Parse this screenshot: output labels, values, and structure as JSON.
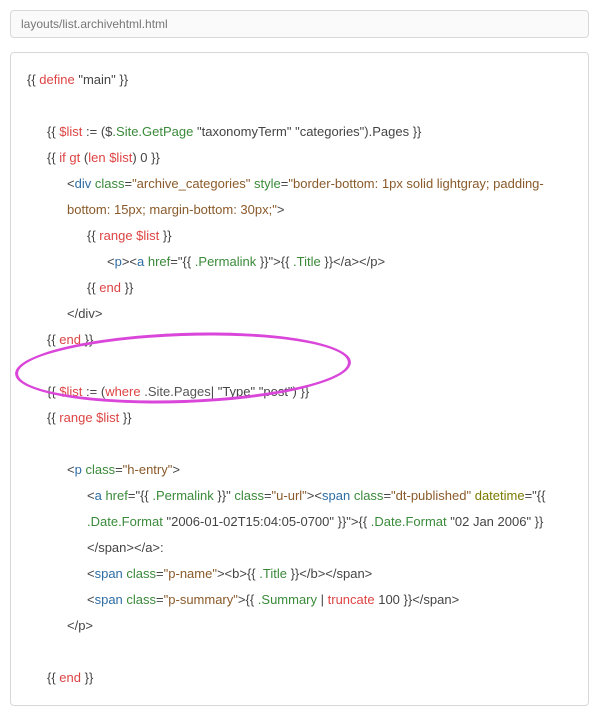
{
  "filename": "layouts/list.archivehtml.html",
  "code": {
    "l1_open": "{{ ",
    "l1_define": "define",
    "l1_rest": " \"main\" }}",
    "l3_open": "{{ ",
    "l3_var": "$list",
    "l3_mid": " := ($",
    "l3_site": ".Site.GetPage",
    "l3_rest": " \"taxonomyTerm\" \"categories\").Pages }}",
    "l4_open": "{{ ",
    "l4_if": "if gt ",
    "l4_paren": "(",
    "l4_len": "len",
    "l4_sp": " ",
    "l4_var": "$list",
    "l4_close": ") 0 }}",
    "l5_open": "<",
    "l5_div": "div",
    "l5_sp": " ",
    "l5_class": "class",
    "l5_eq": "=",
    "l5_classval": "\"archive_categories\"",
    "l5_sp2": " ",
    "l5_style": "style",
    "l5_eq2": "=",
    "l5_styleval": "\"border-bottom: 1px solid lightgray; padding-bottom: 15px; margin-bottom: 30px;\"",
    "l5_gt": ">",
    "l6_open": "{{ ",
    "l6_range": "range ",
    "l6_var": "$list",
    "l6_close": " }}",
    "l7_plt": "<",
    "l7_p": "p",
    "l7_pgt": ">",
    "l7_alt": "<",
    "l7_a": "a",
    "l7_sp": " ",
    "l7_href": "href",
    "l7_eq": "=\"{{ ",
    "l7_perm": ".Permalink",
    "l7_eq2": " }}\">",
    "l7_titleopen": "{{ ",
    "l7_title": ".Title",
    "l7_titleclose": " }}",
    "l7_close": "</a></p>",
    "l8_open": "{{ ",
    "l8_end": "end",
    "l8_close": " }}",
    "l9": "</div>",
    "l10_open": "{{ ",
    "l10_end": "end",
    "l10_close": " }}",
    "l12_open": "{{ ",
    "l12_var": "$list",
    "l12_mid": " := (",
    "l12_where": "where",
    "l12_pages": " .Site.Pages",
    "l12_cursor": "|",
    "l12_args": " \"Type\" \"post\") }}",
    "l13_open": "{{ ",
    "l13_range": "range ",
    "l13_var": "$list",
    "l13_close": " }}",
    "l15_lt": "<",
    "l15_p": "p",
    "l15_sp": " ",
    "l15_class": "class",
    "l15_eq": "=",
    "l15_val": "\"h-entry\"",
    "l15_gt": ">",
    "l16_lt": "<",
    "l16_a": "a",
    "l16_sp": " ",
    "l16_href": "href",
    "l16_eq": "=\"{{ ",
    "l16_perm": ".Permalink",
    "l16_eq2": " }}\" ",
    "l16_class": "class",
    "l16_ceq": "=",
    "l16_cval": "\"u-url\"",
    "l16_gt": ">",
    "l16_slt": "<",
    "l16_span": "span",
    "l16_sp2": " ",
    "l16_sclass": "class",
    "l16_seq": "=",
    "l16_sval": "\"dt-published\"",
    "l16_sp3": " ",
    "l16_dt": "datetime",
    "l16_dteq": "=\"{{ ",
    "l16_dfmt": ".Date.Format",
    "l16_dval": " \"2006-01-02T15:04:05-0700\" }}\">",
    "l16_fopen": "{{ ",
    "l16_dfmt2": ".Date.Format",
    "l16_dval2": " \"02 Jan 2006\" }}",
    "l16_tail": "</span></a>:",
    "l17_lt": "<",
    "l17_span": "span",
    "l17_sp": " ",
    "l17_class": "class",
    "l17_eq": "=",
    "l17_val": "\"p-name\"",
    "l17_gt": "><b>{{ ",
    "l17_title": ".Title",
    "l17_mid": " }}</b></span>",
    "l18_lt": "<",
    "l18_span": "span",
    "l18_sp": " ",
    "l18_class": "class",
    "l18_eq": "=",
    "l18_val": "\"p-summary\"",
    "l18_gt": ">{{ ",
    "l18_sum": ".Summary",
    "l18_pipe": " | ",
    "l18_trunc": "truncate",
    "l18_num": " 100 }}",
    "l18_close": "</span>",
    "l19": "</p>",
    "l21_open": "{{ ",
    "l21_end": "end",
    "l21_close": " }}"
  }
}
